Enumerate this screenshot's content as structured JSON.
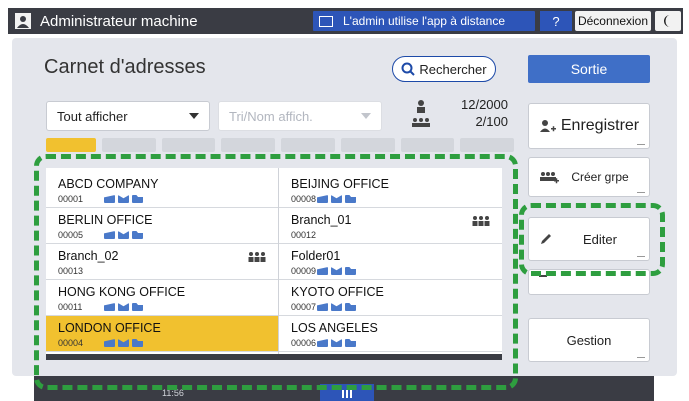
{
  "topbar": {
    "title": "Administrateur machine",
    "remote_badge": "L'admin utilise l'app à distance",
    "help": "?",
    "logout": "Déconnexion",
    "night_icon": "moon-icon"
  },
  "header": {
    "title": "Carnet d'adresses",
    "search": "Rechercher",
    "exit": "Sortie"
  },
  "filters": {
    "display": "Tout afficher",
    "sort_placeholder": "Tri/Nom affich.",
    "count_total": "12/2000",
    "count_groups": "2/100"
  },
  "entries": [
    {
      "name": "ABCD COMPANY",
      "number": "00001",
      "side": "left",
      "selected": false,
      "group": false
    },
    {
      "name": "BEIJING OFFICE",
      "number": "00008",
      "side": "right",
      "selected": false,
      "group": false
    },
    {
      "name": "BERLIN OFFICE",
      "number": "00005",
      "side": "left",
      "selected": false,
      "group": false
    },
    {
      "name": "Branch_01",
      "number": "00012",
      "side": "right",
      "selected": false,
      "group": true
    },
    {
      "name": "Branch_02",
      "number": "00013",
      "side": "left",
      "selected": false,
      "group": true
    },
    {
      "name": "Folder01",
      "number": "00009",
      "side": "right",
      "selected": false,
      "group": false
    },
    {
      "name": "HONG KONG OFFICE",
      "number": "00011",
      "side": "left",
      "selected": false,
      "group": false
    },
    {
      "name": "KYOTO OFFICE",
      "number": "00007",
      "side": "right",
      "selected": false,
      "group": false
    },
    {
      "name": "LONDON OFFICE",
      "number": "00004",
      "side": "left",
      "selected": true,
      "group": false
    },
    {
      "name": "LOS ANGELES",
      "number": "00006",
      "side": "right",
      "selected": false,
      "group": false
    }
  ],
  "side_buttons": {
    "register": "Enregistrer",
    "create_group": "Créer grpe",
    "edit": "Editer",
    "manage": "Gestion"
  },
  "bottombar": {
    "time": "11:56"
  },
  "colors": {
    "highlight": "#2e9e3f",
    "selected_row": "#f1c12f",
    "accent_blue": "#3f6fc7"
  }
}
